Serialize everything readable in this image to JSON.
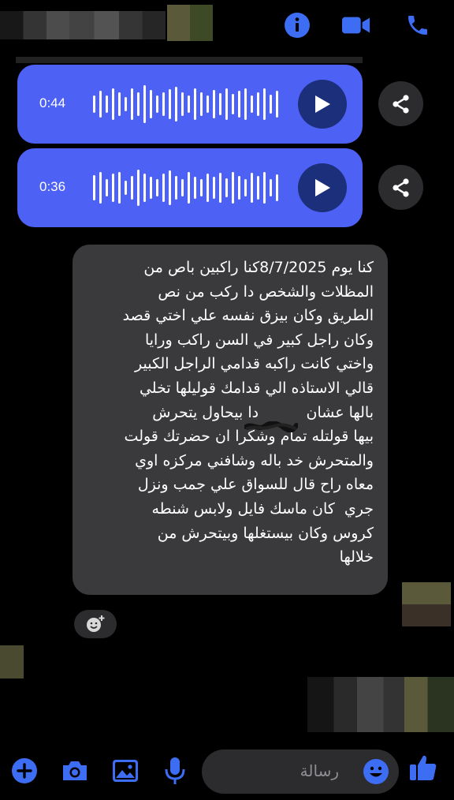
{
  "accent_color": "#4d61f5",
  "header": {
    "icons": [
      "info-icon",
      "video-call-icon",
      "phone-icon"
    ]
  },
  "voice_messages": [
    {
      "duration": "0:44"
    },
    {
      "duration": "0:36"
    }
  ],
  "text_message": {
    "lines": [
      "كنا يوم 8/7/2025كنا راكبين باص من",
      "المظلات والشخص دا ركب من نص",
      "الطريق وكان بيزق نفسه علي اختي قصد",
      "وكان راجل كبير في السن راكب ورايا",
      "واختي كانت راكبه قدامي الراجل الكبير",
      "قالي الاستاذه الي قدامك قوليلها تخلي",
      "بالها عشان          دا بيحاول يتحرش",
      "بيها قولتله تمام وشكرا ان حضرتك قولت",
      "والمتحرش خد باله وشافني مركزه اوي",
      "معاه راح قال للسواق علي جمب ونزل",
      "جري  كان ماسك فايل ولابس شنطه",
      "كروس وكان بيستغلها وبيتحرش من",
      "خلالها"
    ]
  },
  "composer": {
    "placeholder": "رسالة",
    "icons": [
      "add-icon",
      "camera-icon",
      "gallery-icon",
      "microphone-icon",
      "emoji-icon",
      "like-icon"
    ]
  }
}
